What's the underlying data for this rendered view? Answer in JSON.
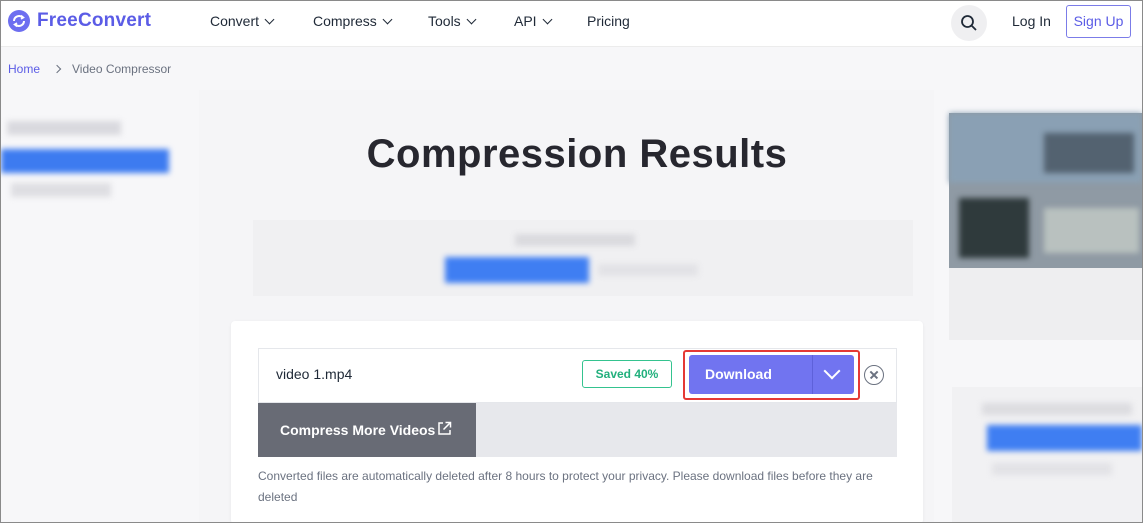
{
  "brand": {
    "name_part1": "Free",
    "name_part2": "Convert"
  },
  "nav": {
    "items": [
      {
        "label": "Convert",
        "has_dropdown": true
      },
      {
        "label": "Compress",
        "has_dropdown": true
      },
      {
        "label": "Tools",
        "has_dropdown": true
      },
      {
        "label": "API",
        "has_dropdown": true
      },
      {
        "label": "Pricing",
        "has_dropdown": false
      }
    ],
    "login": "Log In",
    "signup": "Sign Up"
  },
  "breadcrumb": {
    "home": "Home",
    "current": "Video Compressor"
  },
  "page_title": "Compression Results",
  "result": {
    "file_name": "video 1.mp4",
    "saved_badge": "Saved 40%",
    "download_label": "Download",
    "compress_more_label": "Compress More Videos",
    "note": "Converted files are automatically deleted after 8 hours to protect your privacy. Please download files before they are deleted"
  },
  "colors": {
    "accent": "#7174f0",
    "brand": "#5b5ce6",
    "success": "#22b07d",
    "highlight": "#e53935"
  }
}
